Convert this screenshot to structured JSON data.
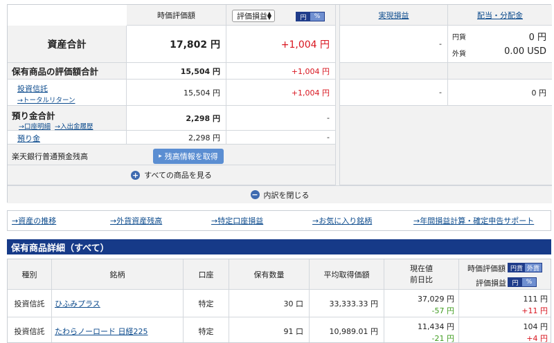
{
  "summary": {
    "col_headers": {
      "valuation": "時価評価額",
      "realized": "実現損益",
      "dividend": "配当・分配金"
    },
    "pl_select": "評価損益",
    "toggle_pl": {
      "yen": "円",
      "pct": "%"
    },
    "total": {
      "label": "資産合計",
      "value": "17,802 円",
      "pl": "+1,004 円",
      "realized": "-",
      "div_yen_label": "円貨",
      "div_yen": "0 円",
      "div_fx_label": "外貨",
      "div_fx": "0.00 USD"
    },
    "holdings": {
      "label": "保有商品の評価額合計",
      "value": "15,504 円",
      "pl": "+1,004 円"
    },
    "fund": {
      "label": "投資信託",
      "sub_link": "→トータルリターン",
      "value": "15,504 円",
      "pl": "+1,004 円",
      "realized": "-",
      "dividend": "0 円"
    },
    "deposit": {
      "label": "預り金合計",
      "link1": "→口座明細",
      "link2": "→入出金履歴",
      "value": "2,298 円",
      "pl": "-"
    },
    "azukari": {
      "label": "預り金",
      "value": "2,298 円",
      "pl": "-"
    },
    "bank": {
      "label": "楽天銀行普通預金残高",
      "button": "残高情報を取得"
    },
    "all_products": "すべての商品を見る",
    "close_breakdown": "内訳を閉じる"
  },
  "links": [
    "→資産の推移",
    "→外貨資産残高",
    "→特定口座損益",
    "→お気に入り銘柄",
    "→年間損益計算・確定申告サポート"
  ],
  "detail": {
    "title": "保有商品詳細（すべて）",
    "headers": {
      "type": "種別",
      "name": "銘柄",
      "account": "口座",
      "qty": "保有数量",
      "avg": "平均取得価額",
      "price1": "現在値",
      "price2": "前日比",
      "val_label": "時価評価額",
      "pl_label": "評価損益",
      "val_toggle": {
        "yen": "円貨",
        "fx": "外貨"
      },
      "pl_toggle": {
        "yen": "円",
        "pct": "%"
      }
    },
    "rows": [
      {
        "type": "投資信託",
        "name": "ひふみプラス",
        "account": "特定",
        "qty": "30 口",
        "avg": "33,333.33 円",
        "price": "37,029 円",
        "change": "-57 円",
        "value": "111 円",
        "pl": "+11 円"
      },
      {
        "type": "投資信託",
        "name": "たわらノーロード 日経225",
        "account": "特定",
        "qty": "91 口",
        "avg": "10,989.01 円",
        "price": "11,434 円",
        "change": "-21 円",
        "value": "104 円",
        "pl": "+4 円"
      }
    ]
  }
}
